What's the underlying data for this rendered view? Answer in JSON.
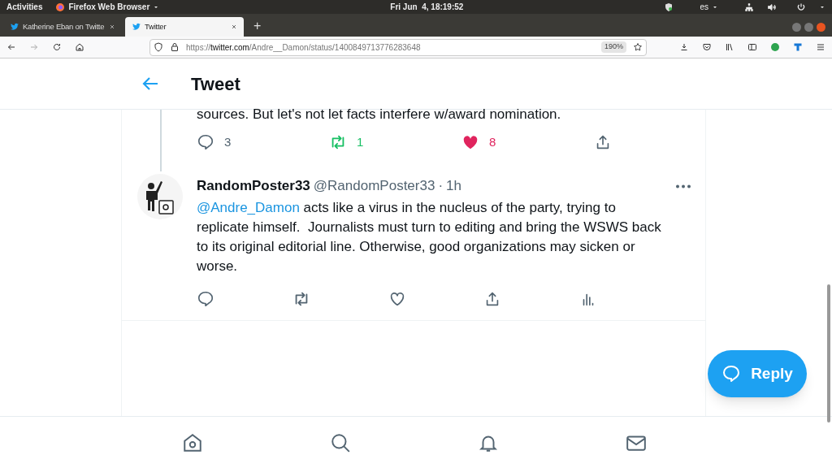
{
  "system_bar": {
    "activities": "Activities",
    "app_menu": "Firefox Web Browser",
    "clock": "Fri Jun  4, 18:19:52",
    "language": "es"
  },
  "tabs": [
    {
      "label": "Katherine Eban on Twitte",
      "selected": false
    },
    {
      "label": "Twitter",
      "selected": true
    }
  ],
  "new_tab": "+",
  "toolbar": {
    "url_prefix": "https://",
    "url_domain": "twitter.com",
    "url_path": "/Andre__Damon/status/1400849713776283648",
    "zoom": "190%"
  },
  "header": {
    "title": "Tweet"
  },
  "parent_tweet": {
    "text": "sources. But let's not let facts interfere w/award nomination.",
    "replies": "3",
    "retweets": "1",
    "likes": "8",
    "retweeted": true,
    "liked": true
  },
  "reply_tweet": {
    "name": "RandomPoster33",
    "handle": "@RandomPoster33",
    "separator": "·",
    "time": "1h",
    "mention": "@Andre_Damon",
    "text": " acts like a virus in the nucleus of the party, trying to replicate himself.  Journalists must turn to editing and bring the WSWS back to its original editorial line. Otherwise, good organizations may sicken or worse.",
    "retweeted": false,
    "liked": false
  },
  "fab": {
    "label": "Reply"
  }
}
